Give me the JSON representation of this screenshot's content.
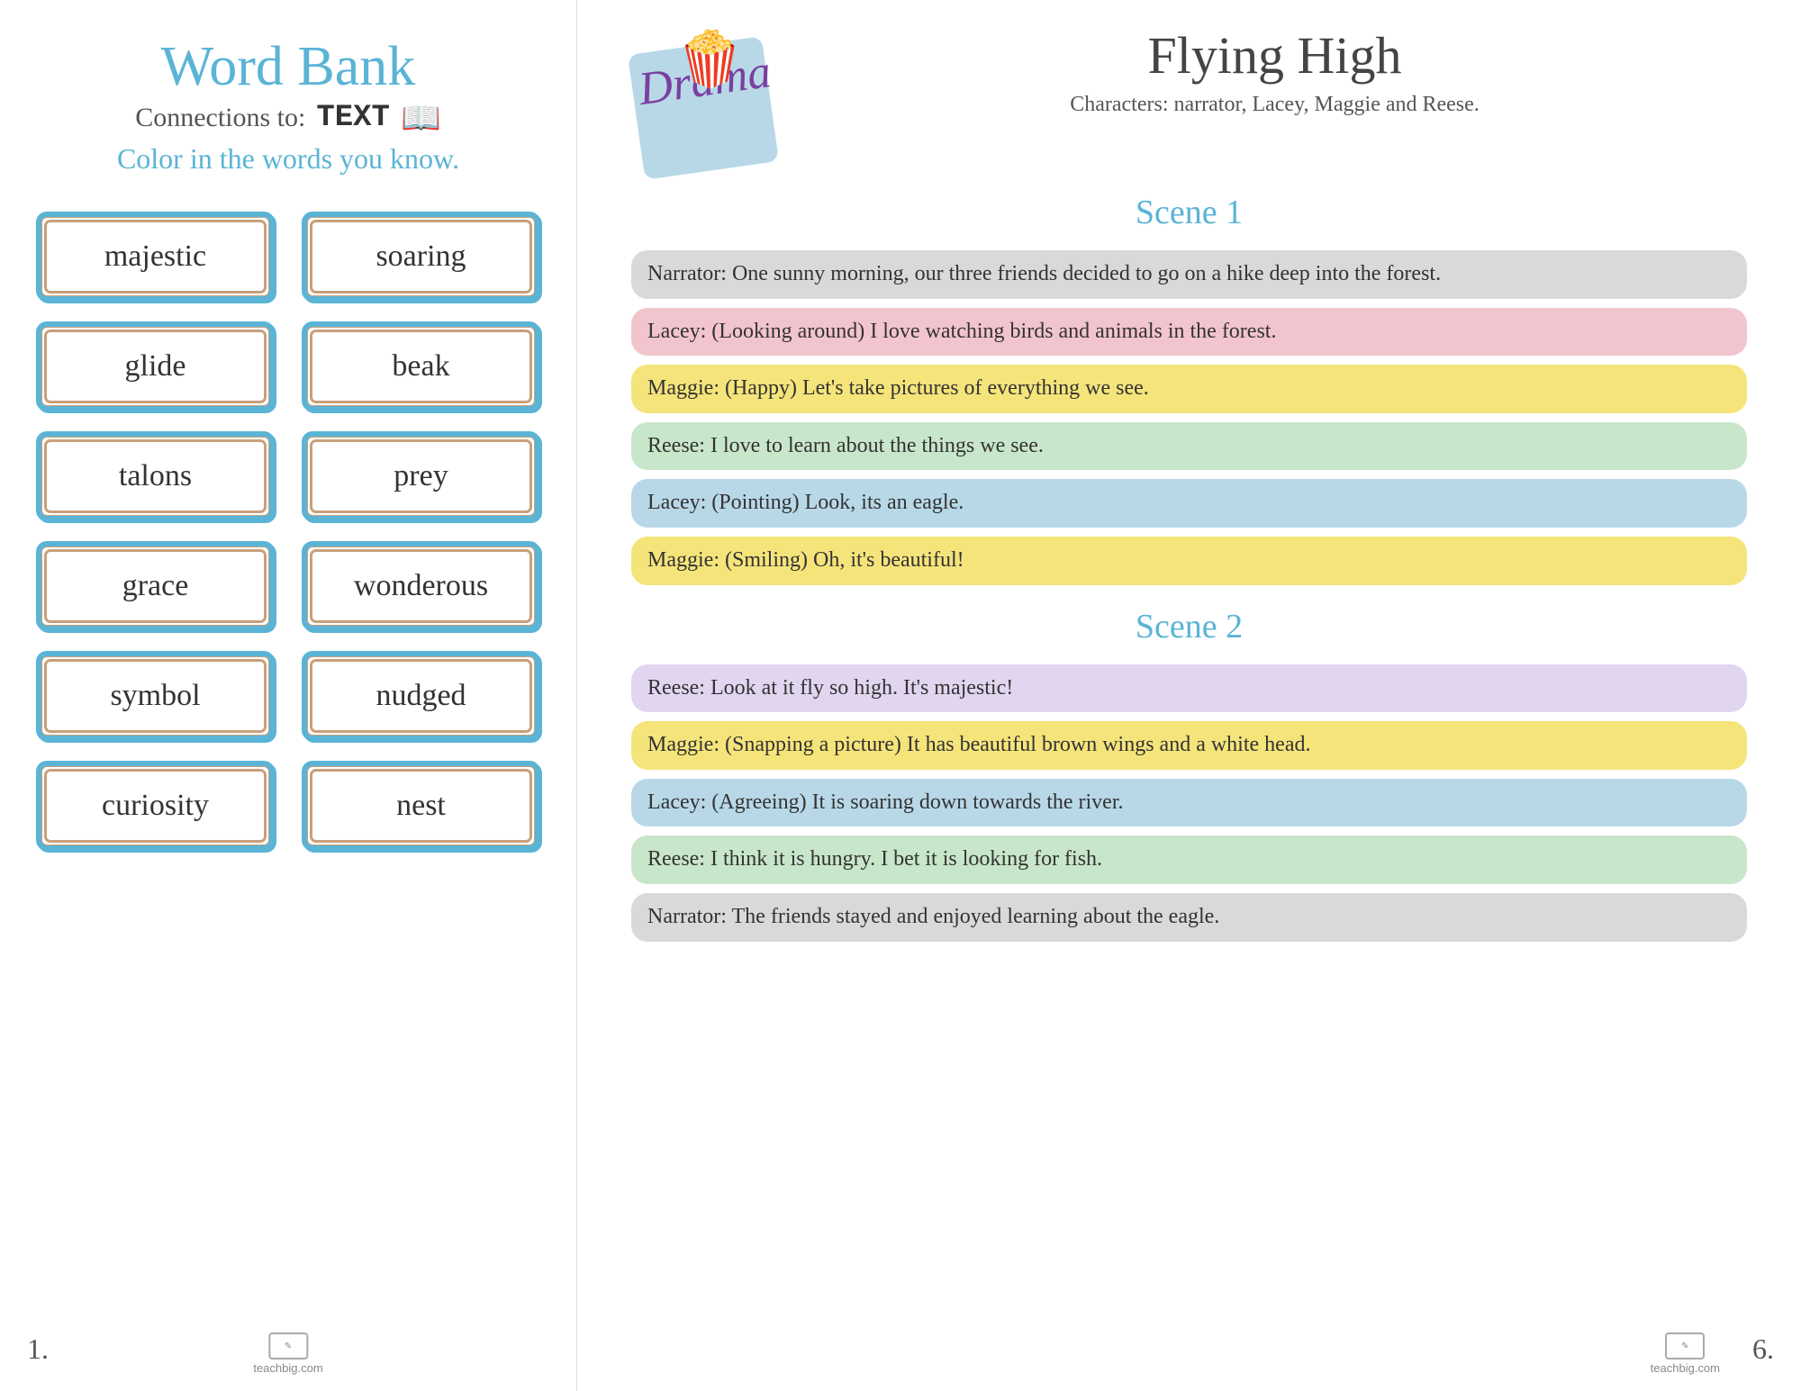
{
  "left": {
    "title": "Word Bank",
    "connections_label": "Connections to:",
    "connections_type": "TEXT",
    "instruction": "Color in the words you know.",
    "words": [
      {
        "word": "majestic"
      },
      {
        "word": "soaring"
      },
      {
        "word": "glide"
      },
      {
        "word": "beak"
      },
      {
        "word": "talons"
      },
      {
        "word": "prey"
      },
      {
        "word": "grace"
      },
      {
        "word": "wonderous"
      },
      {
        "word": "symbol"
      },
      {
        "word": "nudged"
      },
      {
        "word": "curiosity"
      },
      {
        "word": "nest"
      }
    ],
    "page_number": "1.",
    "logo_text": "teachbig.com"
  },
  "right": {
    "drama_label": "Drama",
    "title": "Flying High",
    "characters": "Characters: narrator, Lacey, Maggie  and Reese.",
    "scenes": [
      {
        "scene_title": "Scene 1",
        "lines": [
          {
            "text": "Narrator:  One sunny morning, our three friends decided to go on a hike deep into the forest.",
            "color": "bubble-gray"
          },
          {
            "text": "Lacey: (Looking around) I love watching birds and animals in the forest.",
            "color": "bubble-pink"
          },
          {
            "text": "Maggie: (Happy) Let's take pictures of everything we see.",
            "color": "bubble-yellow"
          },
          {
            "text": "Reese: I love to learn about the things we see.",
            "color": "bubble-green"
          },
          {
            "text": "Lacey: (Pointing) Look, its an eagle.",
            "color": "bubble-blue"
          },
          {
            "text": "Maggie: (Smiling) Oh, it's beautiful!",
            "color": "bubble-yellow"
          }
        ]
      },
      {
        "scene_title": "Scene 2",
        "lines": [
          {
            "text": "Reese: Look at it fly so high. It's majestic!",
            "color": "bubble-lavender"
          },
          {
            "text": "Maggie: (Snapping a picture) It has beautiful brown wings and a white head.",
            "color": "bubble-yellow"
          },
          {
            "text": "Lacey: (Agreeing) It is soaring down towards the river.",
            "color": "bubble-blue"
          },
          {
            "text": "Reese: I think it is hungry. I bet it is looking for fish.",
            "color": "bubble-green"
          },
          {
            "text": "Narrator:  The friends stayed and enjoyed learning about the eagle.",
            "color": "bubble-gray"
          }
        ]
      }
    ],
    "page_number": "6.",
    "logo_text": "teachbig.com"
  }
}
